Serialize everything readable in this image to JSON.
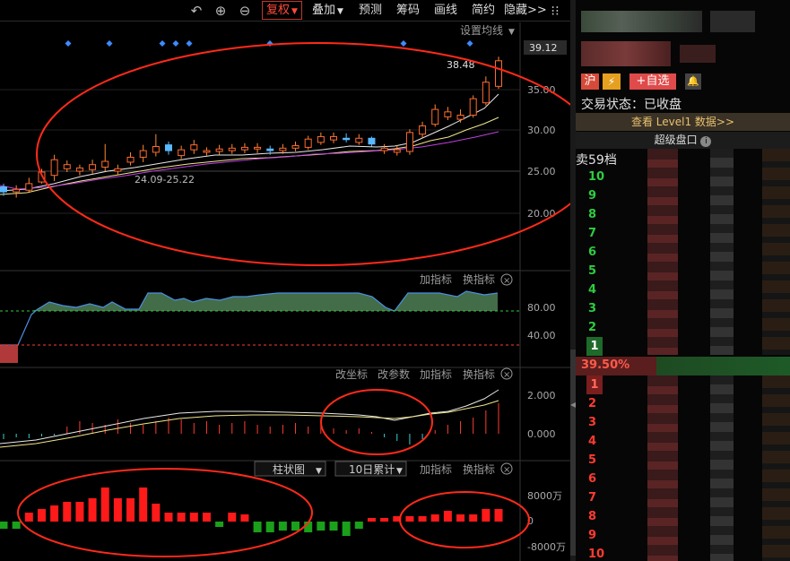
{
  "toolbar": {
    "undo_icon": "undo-icon",
    "zoom_in_icon": "plus-circle-icon",
    "zoom_out_icon": "minus-circle-icon",
    "fuquan_label": "复权",
    "overlay_label": "叠加",
    "forecast_label": "预测",
    "chips_label": "筹码",
    "draw_label": "画线",
    "simple_label": "简约",
    "hide_label": "隐藏>>",
    "more_icon": "grid-dots-icon"
  },
  "main_chart": {
    "ma_settings_label": "设置均线",
    "last_price_label": "39.12",
    "high_label": "38.48",
    "low_label": "24.09-25.22",
    "y_ticks": [
      "35.00",
      "30.00",
      "25.00",
      "20.00"
    ]
  },
  "indicator1": {
    "add_label": "加指标",
    "switch_label": "换指标",
    "y_ticks": [
      "80.00",
      "40.00"
    ]
  },
  "indicator2": {
    "coord_label": "改坐标",
    "param_label": "改参数",
    "add_label": "加指标",
    "switch_label": "换指标",
    "y_ticks": [
      "2.000",
      "0.000"
    ]
  },
  "indicator3": {
    "chart_type_label": "柱状图",
    "period_label": "10日累计",
    "add_label": "加指标",
    "switch_label": "换指标",
    "y_ticks": [
      "8000万",
      "0",
      "-8000万"
    ]
  },
  "colors": {
    "up": "#ff3b30",
    "down": "#2ecc40",
    "ma_white": "#e8e8e8",
    "ma_yellow": "#f0e68c",
    "ma_purple": "#c040e0",
    "annotation_red": "#ff2a1a",
    "diamond": "#3d8bff"
  },
  "right_panel": {
    "market_badge": "沪",
    "add_watch_label": "+自选",
    "trade_status_label": "交易状态：",
    "trade_status_value": "已收盘",
    "level1_label": "查看 Level1 数据>>",
    "super_panel_label": "超级盘口",
    "info_icon": "info-icon",
    "sell_header": "卖59档",
    "sell_levels": [
      "10",
      "9",
      "8",
      "7",
      "6",
      "5",
      "4",
      "3",
      "2",
      "1"
    ],
    "change_pct": "39.50%",
    "buy_levels": [
      "1",
      "2",
      "3",
      "4",
      "5",
      "6",
      "7",
      "8",
      "9",
      "10"
    ]
  },
  "chart_data": {
    "type": "candlestick",
    "title": "",
    "xlabel": "",
    "ylabel": "",
    "ylim": [
      17,
      40
    ],
    "last_price": 39.12,
    "high_marker": 38.48,
    "low_marker": "24.09-25.22",
    "candles": [
      {
        "o": 23.2,
        "c": 22.6,
        "h": 23.6,
        "l": 22.1
      },
      {
        "o": 22.6,
        "c": 22.9,
        "h": 23.4,
        "l": 21.9
      },
      {
        "o": 22.8,
        "c": 23.6,
        "h": 24.3,
        "l": 22.6
      },
      {
        "o": 23.8,
        "c": 25.0,
        "h": 25.4,
        "l": 23.6
      },
      {
        "o": 24.6,
        "c": 26.5,
        "h": 27.1,
        "l": 23.9
      },
      {
        "o": 25.4,
        "c": 25.9,
        "h": 26.4,
        "l": 25.0
      },
      {
        "o": 25.1,
        "c": 25.5,
        "h": 25.9,
        "l": 24.6
      },
      {
        "o": 25.3,
        "c": 25.9,
        "h": 26.5,
        "l": 24.8
      },
      {
        "o": 25.6,
        "c": 26.3,
        "h": 28.4,
        "l": 25.1
      },
      {
        "o": 25.1,
        "c": 25.4,
        "h": 25.9,
        "l": 24.6
      },
      {
        "o": 26.2,
        "c": 26.8,
        "h": 27.4,
        "l": 25.8
      },
      {
        "o": 26.8,
        "c": 27.6,
        "h": 28.3,
        "l": 26.2
      },
      {
        "o": 27.4,
        "c": 28.1,
        "h": 29.6,
        "l": 26.9
      },
      {
        "o": 28.3,
        "c": 27.6,
        "h": 28.7,
        "l": 27.1
      },
      {
        "o": 27.0,
        "c": 27.7,
        "h": 28.2,
        "l": 26.6
      },
      {
        "o": 27.7,
        "c": 28.3,
        "h": 28.9,
        "l": 27.2
      },
      {
        "o": 27.4,
        "c": 27.6,
        "h": 28.0,
        "l": 27.0
      },
      {
        "o": 27.5,
        "c": 27.8,
        "h": 28.3,
        "l": 27.1
      },
      {
        "o": 27.6,
        "c": 27.9,
        "h": 28.4,
        "l": 27.2
      },
      {
        "o": 27.7,
        "c": 28.0,
        "h": 28.5,
        "l": 27.3
      },
      {
        "o": 27.8,
        "c": 28.0,
        "h": 28.5,
        "l": 27.3
      },
      {
        "o": 27.8,
        "c": 27.6,
        "h": 28.2,
        "l": 27.1
      },
      {
        "o": 27.6,
        "c": 27.9,
        "h": 28.4,
        "l": 27.2
      },
      {
        "o": 27.9,
        "c": 28.2,
        "h": 28.7,
        "l": 27.5
      },
      {
        "o": 28.0,
        "c": 29.0,
        "h": 29.4,
        "l": 27.7
      },
      {
        "o": 28.6,
        "c": 29.3,
        "h": 29.8,
        "l": 28.3
      },
      {
        "o": 28.9,
        "c": 29.3,
        "h": 29.8,
        "l": 28.5
      },
      {
        "o": 29.1,
        "c": 29.0,
        "h": 29.7,
        "l": 28.6
      },
      {
        "o": 28.6,
        "c": 29.1,
        "h": 29.6,
        "l": 28.3
      },
      {
        "o": 29.1,
        "c": 28.4,
        "h": 29.3,
        "l": 28.1
      },
      {
        "o": 27.6,
        "c": 27.9,
        "h": 28.4,
        "l": 27.2
      },
      {
        "o": 27.4,
        "c": 27.7,
        "h": 28.2,
        "l": 27.0
      },
      {
        "o": 27.5,
        "c": 29.8,
        "h": 30.2,
        "l": 27.1
      },
      {
        "o": 29.6,
        "c": 30.6,
        "h": 31.1,
        "l": 29.1
      },
      {
        "o": 30.8,
        "c": 32.6,
        "h": 33.2,
        "l": 30.5
      },
      {
        "o": 31.7,
        "c": 32.3,
        "h": 32.9,
        "l": 31.3
      },
      {
        "o": 31.4,
        "c": 31.9,
        "h": 32.6,
        "l": 31.0
      },
      {
        "o": 31.9,
        "c": 33.9,
        "h": 34.3,
        "l": 31.6
      },
      {
        "o": 33.4,
        "c": 35.9,
        "h": 36.6,
        "l": 33.1
      },
      {
        "o": 35.4,
        "c": 38.5,
        "h": 39.0,
        "l": 35.1
      }
    ]
  }
}
